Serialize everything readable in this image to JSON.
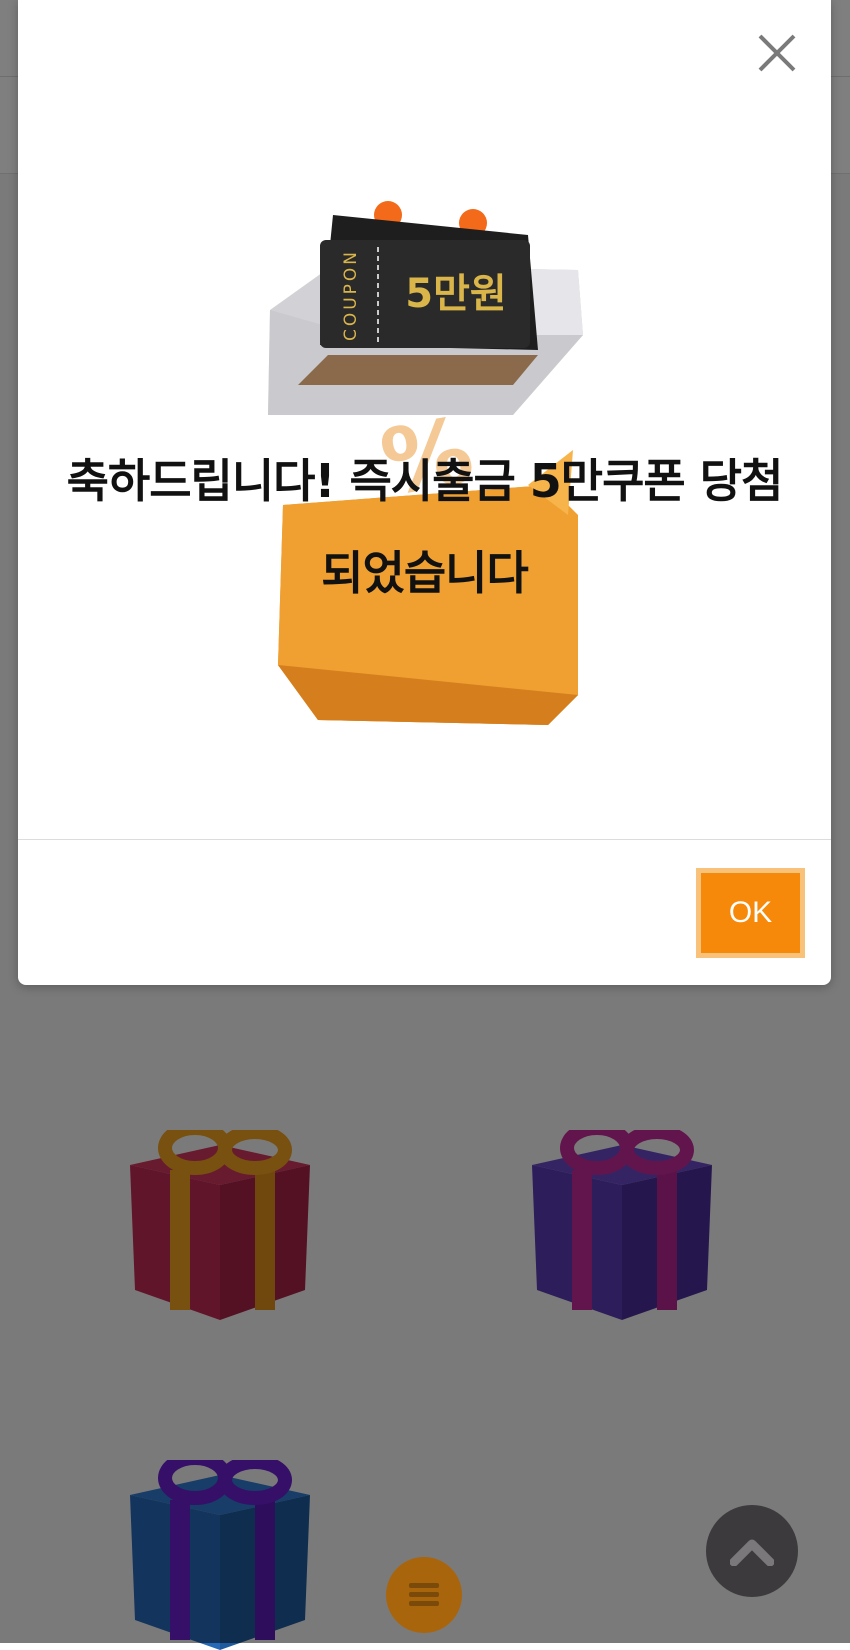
{
  "modal": {
    "message_line1": "축하드립니다! 즉시출금 5만쿠폰 당첨",
    "message_line2": "되었습니다",
    "ok_label": "OK",
    "coupon": {
      "side_text": "COUPON",
      "amount": "5만원"
    }
  },
  "colors": {
    "accent": "#f7890a",
    "ok_border": "#f9c27a",
    "overlay": "rgba(0,0,0,0.5)"
  },
  "icons": {
    "close": "close-icon",
    "scroll_top": "chevron-up-icon",
    "menu": "menu-icon"
  }
}
